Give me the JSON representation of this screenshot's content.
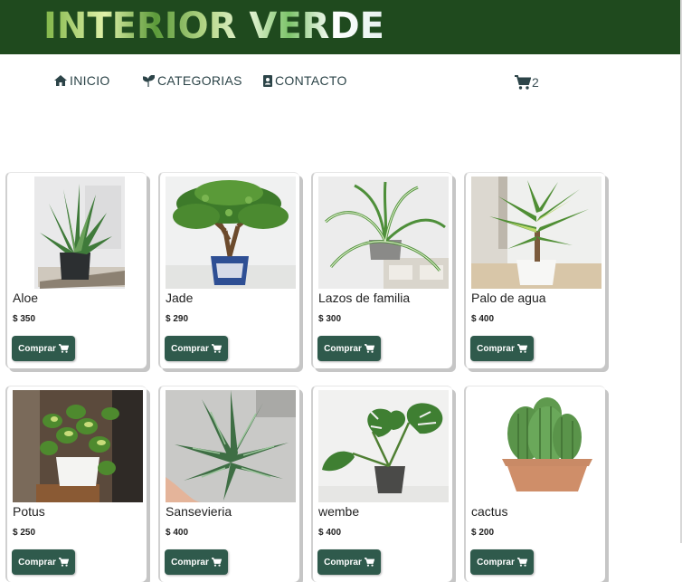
{
  "header": {
    "logo_text": "INTERIOR VERDE"
  },
  "nav": {
    "items": [
      {
        "label": "Inicio",
        "icon": "home-icon"
      },
      {
        "label": "Categorias",
        "icon": "sprout-icon"
      },
      {
        "label": "Contacto",
        "icon": "contact-book-icon"
      }
    ],
    "cart": {
      "count": "2",
      "icon": "shopping-cart-icon"
    }
  },
  "products": [
    {
      "name": "Aloe",
      "price": "$ 350",
      "button": "Comprar",
      "image": "aloe-plant-image"
    },
    {
      "name": "Jade",
      "price": "$ 290",
      "button": "Comprar",
      "image": "jade-plant-image"
    },
    {
      "name": "Lazos de familia",
      "price": "$ 300",
      "button": "Comprar",
      "image": "spider-plant-image"
    },
    {
      "name": "Palo de agua",
      "price": "$ 400",
      "button": "Comprar",
      "image": "dracaena-plant-image"
    },
    {
      "name": "Potus",
      "price": "$ 250",
      "button": "Comprar",
      "image": "pothos-plant-image"
    },
    {
      "name": "Sansevieria",
      "price": "$ 400",
      "button": "Comprar",
      "image": "sansevieria-plant-image"
    },
    {
      "name": "wembe",
      "price": "$ 400",
      "button": "Comprar",
      "image": "monstera-plant-image"
    },
    {
      "name": "cactus",
      "price": "$ 200",
      "button": "Comprar",
      "image": "cactus-plant-image"
    }
  ],
  "colors": {
    "header_bg": "#1f4a1e",
    "button_bg": "#2f5a4c",
    "nav_text": "#2c4448"
  }
}
